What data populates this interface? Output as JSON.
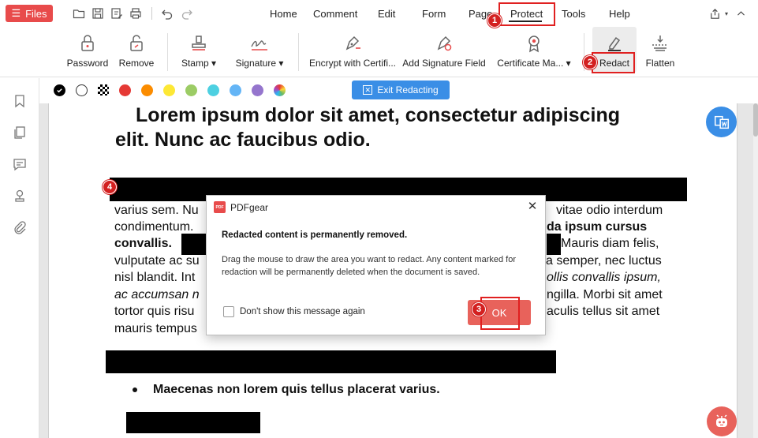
{
  "topbar": {
    "files_label": "Files",
    "menus": [
      "Home",
      "Comment",
      "Edit",
      "Form",
      "Page",
      "Protect",
      "Tools",
      "Help"
    ],
    "active_menu": "Protect"
  },
  "ribbon": {
    "tools": [
      {
        "label": "Password",
        "icon": "lock-icon"
      },
      {
        "label": "Remove",
        "icon": "unlock-icon"
      },
      {
        "label": "Stamp ▾",
        "icon": "stamp-icon"
      },
      {
        "label": "Signature ▾",
        "icon": "signature-icon"
      },
      {
        "label": "Encrypt with Certifi...",
        "icon": "pen-certificate-icon"
      },
      {
        "label": "Add Signature Field",
        "icon": "signature-field-icon"
      },
      {
        "label": "Certificate Ma... ▾",
        "icon": "certificate-icon"
      },
      {
        "label": "Redact",
        "icon": "redact-icon"
      },
      {
        "label": "Flatten",
        "icon": "flatten-icon"
      }
    ],
    "active_tool": "Redact"
  },
  "redact_toolbar": {
    "colors": [
      "#000000",
      "#ffffff",
      "checker",
      "#e53935",
      "#fb8c00",
      "#fdd835",
      "#9ccc65",
      "#4dd0e1",
      "#64b5f6",
      "#9575cd",
      "rainbow"
    ],
    "exit_label": "Exit Redacting"
  },
  "document": {
    "heading_line1": "Lorem ipsum dolor sit amet, consectetur adipiscing",
    "heading_line2": "elit. Nunc ac faucibus odio.",
    "p_line1_left": "varius sem. Nu",
    "p_line1_right": "vitae odio interdum",
    "p_line2_left": "condimentum.",
    "p_line2_right": "da ipsum cursus",
    "p_line3_left": "convallis.",
    "p_line3_right": "Mauris diam felis,",
    "p_line4_left": "vulputate ac su",
    "p_line4_right": "a semper, nec luctus",
    "p_line5_left": "nisl blandit. Int",
    "p_line5_right": "ollis convallis ipsum,",
    "p_line6_left": "ac accumsan n",
    "p_line6_right": "ngilla. Morbi sit amet",
    "p_line7_left": "tortor quis risu",
    "p_line7_right": "aculis tellus sit amet",
    "p_line8_left": "mauris tempus",
    "bullet": "Maecenas non lorem quis tellus placerat varius."
  },
  "dialog": {
    "app_name": "PDFgear",
    "logo_text": "PDF",
    "heading": "Redacted content is permanently removed.",
    "body": "Drag the mouse to draw the area you want to redact. Any content marked for redaction will be permanently deleted when the document is saved.",
    "checkbox_label": "Don't show this message again",
    "ok_label": "OK"
  },
  "annotations": {
    "steps": [
      "1",
      "2",
      "3",
      "4"
    ],
    "marker_color": "#d32020"
  }
}
